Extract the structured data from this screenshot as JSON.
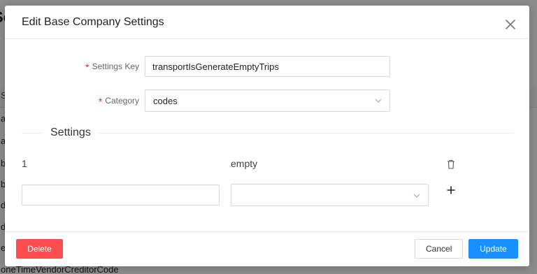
{
  "background": {
    "title_fragment": "Sc",
    "header_fragment": "S",
    "rows": [
      "a",
      "a",
      "b",
      "b",
      "d",
      "d",
      "e",
      "oneTimeVendorCreditorCode"
    ]
  },
  "modal": {
    "title": "Edit Base Company Settings",
    "close_icon": "close-icon"
  },
  "form": {
    "settings_key": {
      "label": "Settings Key",
      "value": "transportIsGenerateEmptyTrips"
    },
    "category": {
      "label": "Category",
      "value": "codes"
    }
  },
  "settings_section": {
    "title": "Settings",
    "items": [
      {
        "index": "1",
        "value": "empty"
      }
    ],
    "new_item": {
      "key_placeholder": "",
      "value_placeholder": ""
    }
  },
  "footer": {
    "delete_label": "Delete",
    "cancel_label": "Cancel",
    "update_label": "Update"
  },
  "colors": {
    "primary": "#1890ff",
    "danger": "#ff4d4f",
    "required": "#f5222d"
  }
}
